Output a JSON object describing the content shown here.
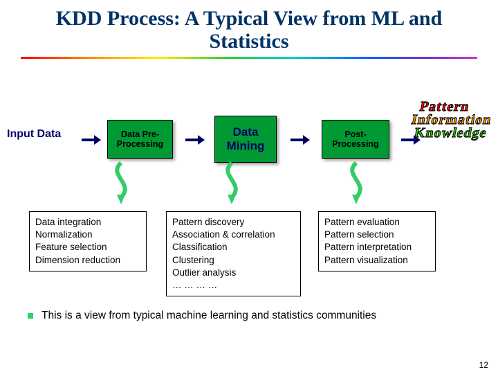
{
  "title": "KDD Process: A Typical View from ML and Statistics",
  "flow": {
    "input_label": "Input Data",
    "box_preproc": "Data Pre-Processing",
    "box_mining": "Data Mining",
    "box_postproc": "Post-Processing"
  },
  "wordstack": {
    "w1": "Pattern",
    "w2": "Information",
    "w3": "Knowledge"
  },
  "details": {
    "preproc": "Data integration\nNormalization\nFeature selection\nDimension reduction",
    "mining": "Pattern discovery\nAssociation & correlation\nClassification\nClustering\nOutlier analysis\n… … … …",
    "postproc": "Pattern evaluation\nPattern selection\nPattern interpretation\nPattern visualization"
  },
  "bullet": "This is a view from typical machine learning and statistics communities",
  "page_number": "12"
}
